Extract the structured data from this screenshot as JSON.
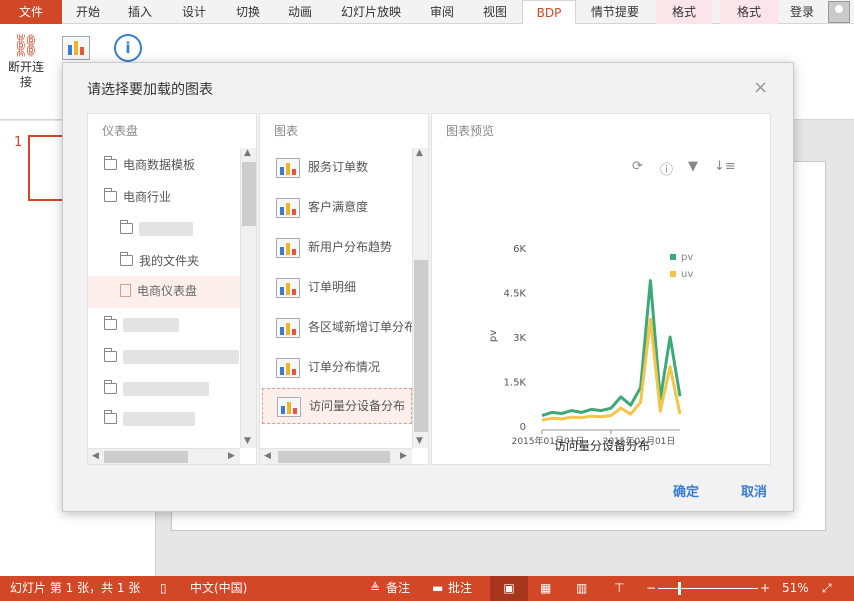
{
  "ribbon": {
    "file": "文件",
    "tabs": [
      "开始",
      "插入",
      "设计",
      "切换",
      "动画",
      "幻灯片放映",
      "审阅",
      "视图",
      "BDP",
      "情节提要",
      "格式",
      "格式"
    ],
    "login": "登录",
    "disconnect_label": "断开连接"
  },
  "slide_panel": {
    "number": "1"
  },
  "dialog": {
    "title": "请选择要加载的图表",
    "close": "×",
    "dashboards": {
      "header": "仪表盘",
      "items": [
        "电商数据模板",
        "电商行业",
        "我的文件夹",
        "电商仪表盘"
      ]
    },
    "charts": {
      "header": "图表",
      "items": [
        "服务订单数",
        "客户满意度",
        "新用户分布趋势",
        "订单明细",
        "各区域新增订单分布",
        "订单分布情况",
        "访问量分设备分布"
      ]
    },
    "preview": {
      "header": "图表预览"
    },
    "ok": "确定",
    "cancel": "取消"
  },
  "chart_data": {
    "type": "line",
    "title": "访问量分设备分布",
    "ylabel": "pv",
    "ylim": [
      0,
      6000
    ],
    "yticks": [
      "0",
      "1.5K",
      "3K",
      "4.5K",
      "6K"
    ],
    "xticks": [
      "2015年01月01日",
      "2015年02月01日"
    ],
    "legend": {
      "position": "top-right"
    },
    "x": [
      "2015-01-01",
      "2015-01-05",
      "2015-01-10",
      "2015-01-15",
      "2015-01-20",
      "2015-01-25",
      "2015-01-30",
      "2015-02-01",
      "2015-02-03",
      "2015-02-05",
      "2015-02-07",
      "2015-02-09",
      "2015-02-11",
      "2015-02-13",
      "2015-02-15"
    ],
    "series": [
      {
        "name": "pv",
        "color": "#3fa877",
        "values": [
          350,
          460,
          420,
          520,
          460,
          560,
          520,
          600,
          980,
          700,
          1300,
          4900,
          900,
          3000,
          1000
        ]
      },
      {
        "name": "uv",
        "color": "#f2c64a",
        "values": [
          200,
          260,
          240,
          300,
          280,
          330,
          310,
          350,
          600,
          400,
          800,
          3600,
          500,
          2000,
          400
        ]
      }
    ]
  },
  "status": {
    "slide_info": "幻灯片 第 1 张，共 1 张",
    "language": "中文(中国)",
    "notes": "备注",
    "comments": "批注",
    "zoom": "51%"
  }
}
